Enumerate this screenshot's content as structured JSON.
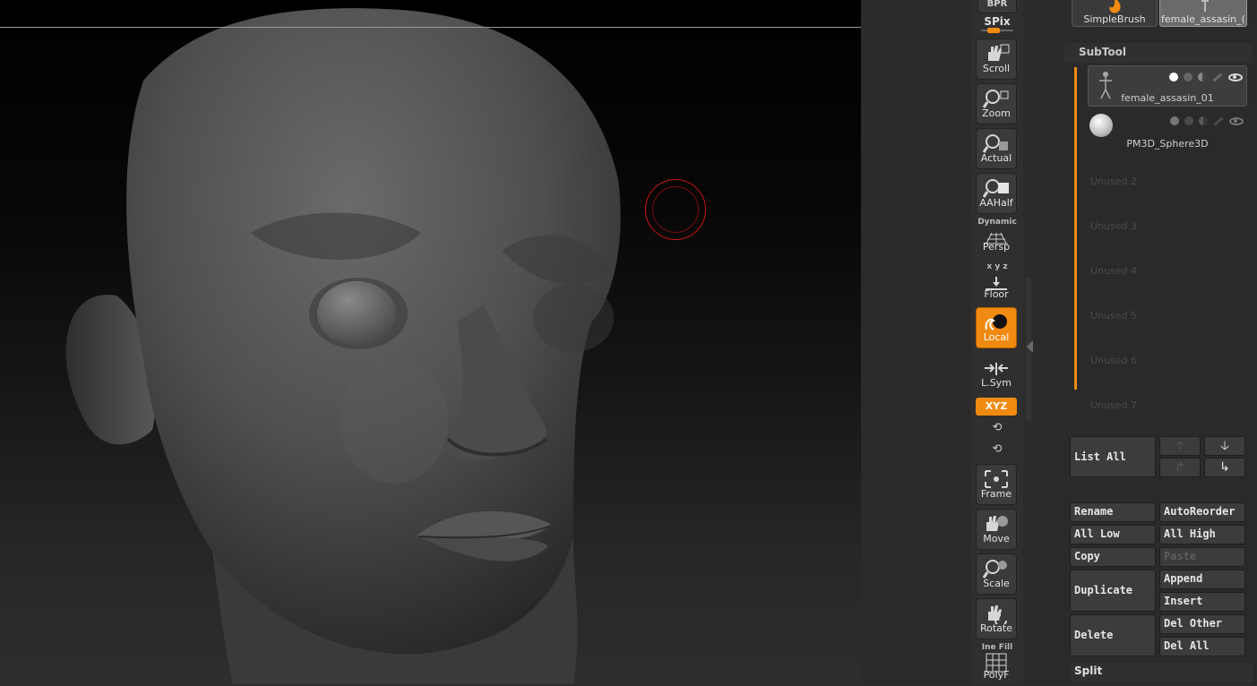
{
  "viewport": {
    "label": "3D head sculpt viewport"
  },
  "shelf": {
    "bpr": "BPR",
    "spix": "SPix",
    "buttons": [
      {
        "label": "Scroll",
        "icon": "scroll-hand-icon"
      },
      {
        "label": "Zoom",
        "icon": "zoom-icon"
      },
      {
        "label": "Actual",
        "icon": "actual-size-icon"
      },
      {
        "label": "AAHalf",
        "icon": "aahalf-icon"
      },
      {
        "label": "Persp",
        "icon": "perspective-grid-icon",
        "top": "Dynamic"
      },
      {
        "label": "Floor",
        "icon": "floor-icon",
        "axes": "x y z"
      },
      {
        "label": "Local",
        "icon": "local-symmetry-icon",
        "active": true
      },
      {
        "label": "L.Sym",
        "icon": "lsym-icon"
      },
      {
        "label": "Frame",
        "icon": "frame-icon"
      },
      {
        "label": "Move",
        "icon": "move-hand-icon"
      },
      {
        "label": "Scale",
        "icon": "scale-icon"
      },
      {
        "label": "Rotate",
        "icon": "rotate-icon"
      },
      {
        "label": "PolyF",
        "icon": "polyframe-icon",
        "top": "Ine Fill"
      }
    ],
    "xyz": "XYZ"
  },
  "panel": {
    "tool_thumbs": [
      "SimpleBrush",
      "female_assasin_("
    ],
    "subtool_title": "SubTool",
    "subtools": [
      {
        "name": "female_assasin_01",
        "selected": true
      },
      {
        "name": "PM3D_Sphere3D",
        "selected": false
      }
    ],
    "unused": [
      "Unused  2",
      "Unused  3",
      "Unused  4",
      "Unused  5",
      "Unused  6",
      "Unused  7"
    ],
    "list_all": "List All",
    "actions": {
      "rename": "Rename",
      "autoreorder": "AutoReorder",
      "all_low": "All Low",
      "all_high": "All High",
      "copy": "Copy",
      "paste": "Paste",
      "duplicate": "Duplicate",
      "append": "Append",
      "insert": "Insert",
      "delete": "Delete",
      "del_other": "Del Other",
      "del_all": "Del All",
      "split": "Split"
    },
    "arrows": {
      "up": "🡡",
      "down": "🡣",
      "redirect": "↱",
      "redirect2": "↳"
    }
  }
}
